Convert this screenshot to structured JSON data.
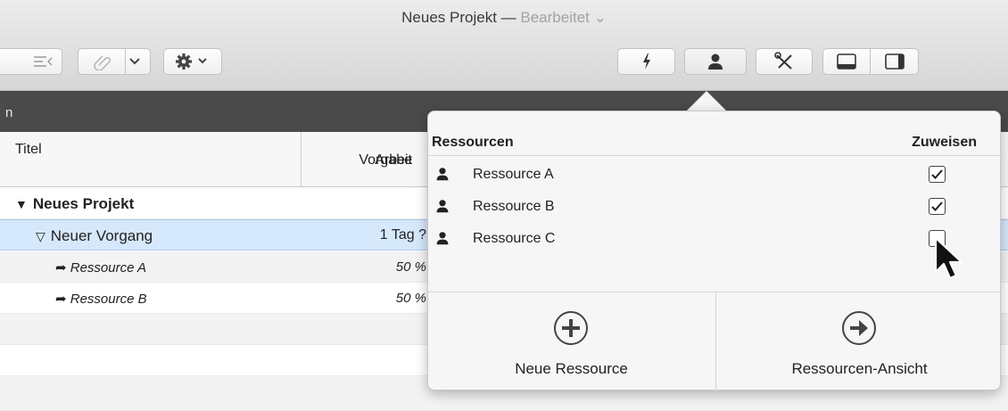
{
  "window": {
    "title": "Neues Projekt",
    "separator": " — ",
    "status": "Bearbeitet",
    "status_chevron": "⌄"
  },
  "toolbar": {
    "left_buttons": [
      "outdent-icon",
      "link-icon",
      "chevron-down-icon",
      "gear-icon"
    ],
    "right_buttons": [
      "lightning-icon",
      "person-icon",
      "tools-icon",
      "bottom-panel-icon",
      "side-panel-icon"
    ]
  },
  "band": {
    "text": "n"
  },
  "table": {
    "headers": {
      "title": "Titel",
      "work_line1": "Vorgabe",
      "work_line2": "Arbeit"
    },
    "rows": [
      {
        "title": "Neues Projekt",
        "value": ""
      },
      {
        "title": "Neuer Vorgang",
        "value": "1 Tag ?"
      },
      {
        "title": "Ressource A",
        "value": "50 %"
      },
      {
        "title": "Ressource B",
        "value": "50 %"
      }
    ]
  },
  "popover": {
    "header_resources": "Ressourcen",
    "header_assign": "Zuweisen",
    "resources": [
      {
        "name": "Ressource A",
        "assigned": true
      },
      {
        "name": "Ressource B",
        "assigned": true
      },
      {
        "name": "Ressource C",
        "assigned": false
      }
    ],
    "new_resource_label": "Neue Ressource",
    "resource_view_label": "Ressourcen-Ansicht"
  },
  "colors": {
    "band": "#4a4a4a",
    "selection": "#d6e8fb",
    "popover": "#f6f6f6"
  }
}
